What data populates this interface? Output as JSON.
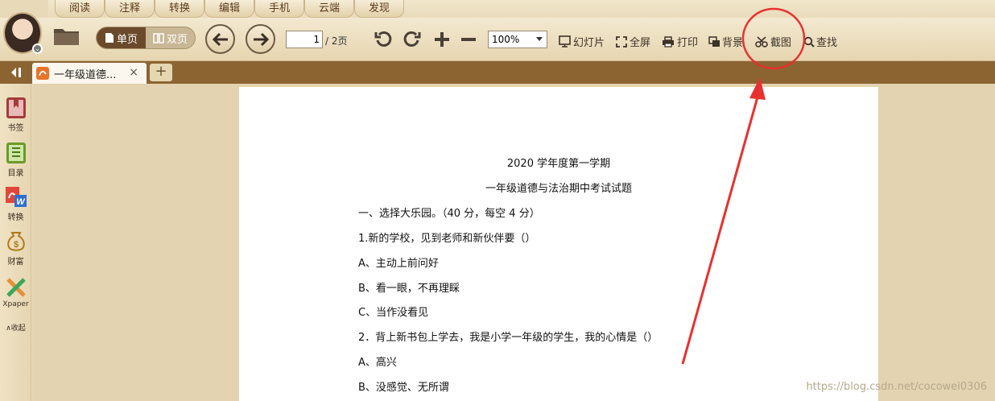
{
  "menu_tabs": [
    "阅读",
    "注释",
    "转换",
    "编辑",
    "手机",
    "云端",
    "发现"
  ],
  "toolbar": {
    "single_page": "单页",
    "double_page": "双页",
    "page_current": "1",
    "page_total": "/ 2页",
    "zoom": "100%",
    "slideshow": "幻灯片",
    "fullscreen": "全屏",
    "print": "打印",
    "background": "背景",
    "screenshot": "截图",
    "find": "查找"
  },
  "tabbar": {
    "doc_tab_title": "一年级道德...",
    "close": "×",
    "new_tab": "+"
  },
  "sidebar": {
    "items": [
      {
        "label": "书签",
        "icon": "bookmark-icon"
      },
      {
        "label": "目录",
        "icon": "toc-icon"
      },
      {
        "label": "转换",
        "icon": "convert-icon"
      },
      {
        "label": "财富",
        "icon": "wealth-icon"
      },
      {
        "label": "Xpaper",
        "icon": "xpaper-icon"
      }
    ],
    "collapse": "∧收起"
  },
  "document": {
    "lines": [
      "2020 学年度第一学期",
      "一年级道德与法治期中考试试题",
      "一、选择大乐园。（40 分，每空 4 分）",
      "1.新的学校，见到老师和新伙伴要（）",
      "A、主动上前问好",
      "B、看一眼，不再理睬",
      "C、当作没看见",
      "2．背上新书包上学去，我是小学一年级的学生，我的心情是（）",
      "A、高兴",
      "B、没感觉、无所谓"
    ]
  },
  "watermark": "https://blog.csdn.net/cocowei0306",
  "colors": {
    "toolbar_bg": "#efe3c6",
    "tabbar_bg": "#8c6432",
    "annotation_red": "#e8302f"
  }
}
